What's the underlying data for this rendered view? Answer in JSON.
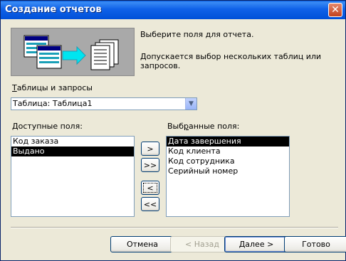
{
  "window": {
    "title": "Создание отчетов",
    "close_icon": "close-icon"
  },
  "info": {
    "line1": "Выберите поля для отчета.",
    "line2": "Допускается выбор нескольких таблиц или запросов."
  },
  "tables": {
    "label_access": "Т",
    "label_rest": "аблицы и запросы",
    "selected": "Таблица: Таблица1"
  },
  "available": {
    "label_access": "Д",
    "label_rest": "оступные поля:",
    "items": [
      "Код заказа",
      "Выдано"
    ],
    "selected_index": 1
  },
  "selected_fields": {
    "label_pre": "Выб",
    "label_access": "р",
    "label_rest": "анные поля:",
    "items": [
      "Дата завершения",
      "Код клиента",
      "Код сотрудника",
      "Серийный номер"
    ],
    "selected_index": 0
  },
  "move_buttons": {
    "add_one": ">",
    "add_all": ">>",
    "remove_one": "<",
    "remove_all": "<<"
  },
  "footer": {
    "cancel": "Отмена",
    "back": "< Назад",
    "next": "Далее >",
    "finish": "Готово"
  },
  "colors": {
    "titlebar": "#0054e3",
    "selection": "#000000",
    "art_background": "#a9a9a9",
    "arrow": "#00e5f0"
  }
}
